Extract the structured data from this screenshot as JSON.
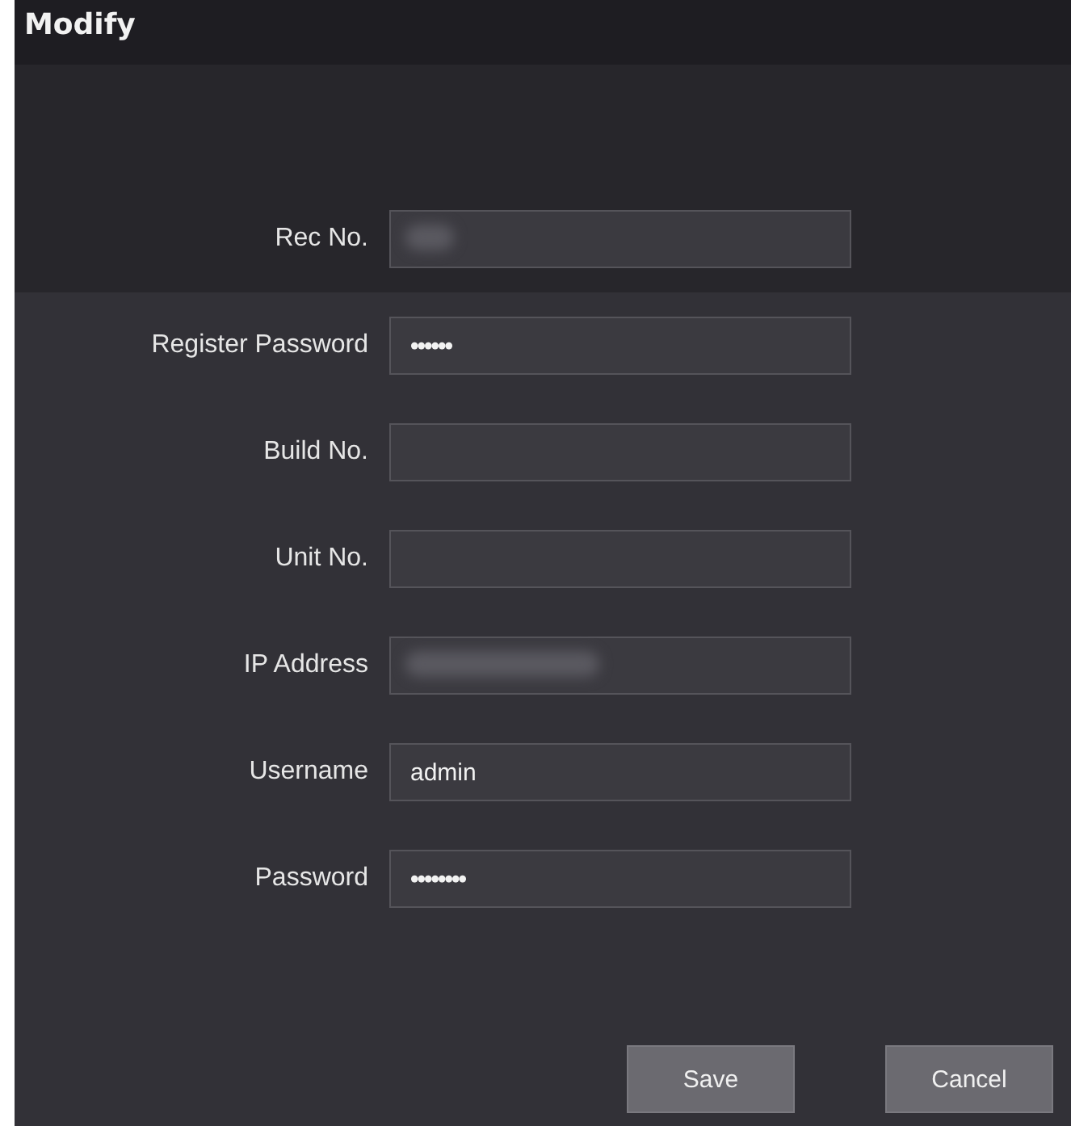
{
  "dialog": {
    "title": "Modify"
  },
  "fields": [
    {
      "label": "Rec No.",
      "redacted": true
    },
    {
      "label": "Register Password",
      "value": "••••••",
      "redacted": false
    },
    {
      "label": "Build No.",
      "redacted": false
    },
    {
      "label": "Unit No.",
      "redacted": false
    },
    {
      "label": "IP Address",
      "redacted": true
    },
    {
      "label": "Username",
      "value": "admin",
      "redacted": false
    },
    {
      "label": "Password",
      "value": "••••••••",
      "redacted": false
    }
  ],
  "buttons": [
    "Save",
    "Cancel"
  ]
}
